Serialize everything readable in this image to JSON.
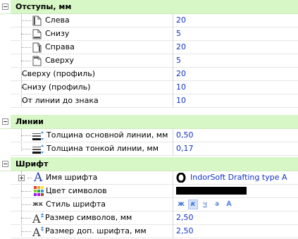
{
  "categories": [
    {
      "label": "Отступы, мм",
      "expander": "minus"
    },
    {
      "label": "Линии",
      "expander": "minus"
    },
    {
      "label": "Шрифт",
      "expander": "minus"
    }
  ],
  "indent_rows": [
    {
      "label": "Слева",
      "value": "20",
      "icon": "page-left-icon"
    },
    {
      "label": "Снизу",
      "value": "5",
      "icon": "page-bottom-icon"
    },
    {
      "label": "Справа",
      "value": "20",
      "icon": "page-right-icon"
    },
    {
      "label": "Сверху",
      "value": "5",
      "icon": "page-top-icon"
    },
    {
      "label": "Сверху (профиль)",
      "value": "20"
    },
    {
      "label": "Снизу (профиль)",
      "value": "10"
    },
    {
      "label": "От линии до знака",
      "value": "10"
    }
  ],
  "line_rows": [
    {
      "label": "Толщина основной линии, мм",
      "value": "0,50",
      "icon": "line-width-icon"
    },
    {
      "label": "Толщина тонкой линии, мм",
      "value": "0,17",
      "icon": "line-width-icon"
    }
  ],
  "font_rows": {
    "font_name": {
      "label": "Имя шрифта",
      "value": "IndorSoft Drafting type A",
      "expander": "plus",
      "icon": "font-a-icon",
      "value_icon": "opentype-font-icon"
    },
    "font_color": {
      "label": "Цвет символов",
      "color": "#000000",
      "icon": "color-palette-icon"
    },
    "font_style": {
      "label": "Стиль шрифта",
      "icon_text": "жк",
      "buttons": [
        "ж",
        "к",
        "ч",
        "з",
        "A"
      ],
      "active_index": 1
    },
    "font_size": {
      "label": "Размер символов, мм",
      "value": "2,50",
      "icon": "font-size-icon"
    },
    "font_size_extra": {
      "label": "Размер доп. шрифта, мм",
      "value": "2,50",
      "icon": "font-size-icon"
    }
  },
  "colors": {
    "category_bg": "#d8f7c6",
    "value_text": "#1233c4"
  }
}
